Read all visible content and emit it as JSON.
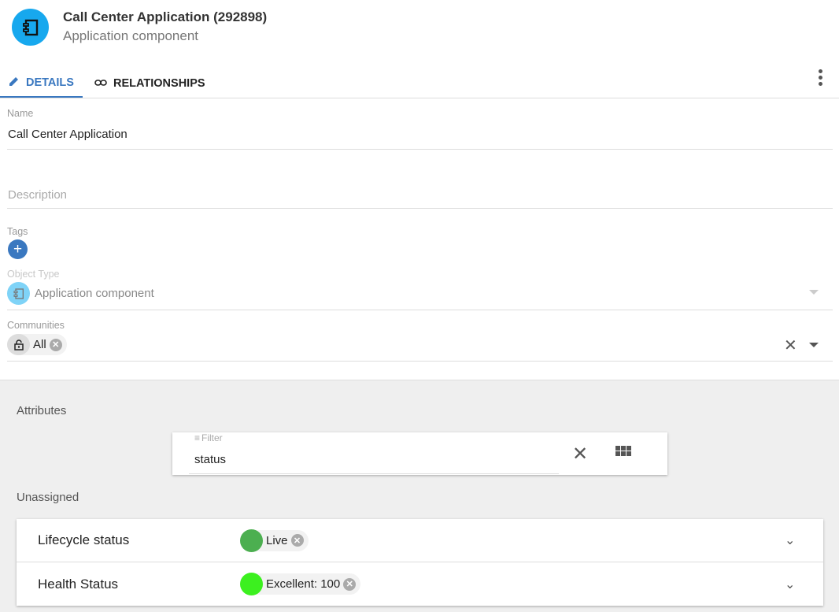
{
  "header": {
    "title": "Call Center Application (292898)",
    "subtitle": "Application component",
    "icon": "application-component-icon",
    "icon_color": "#17a8ee"
  },
  "tabs": [
    {
      "label": "DETAILS",
      "icon": "pencil-icon",
      "active": true
    },
    {
      "label": "RELATIONSHIPS",
      "icon": "link-icon",
      "active": false
    }
  ],
  "form": {
    "name_label": "Name",
    "name_value": "Call Center Application",
    "description_placeholder": "Description",
    "tags_label": "Tags",
    "object_type_label": "Object Type",
    "object_type_value": "Application component",
    "communities_label": "Communities",
    "community_chip": "All"
  },
  "attributes": {
    "title": "Attributes",
    "filter_label": "Filter",
    "filter_value": "status",
    "unassigned_label": "Unassigned",
    "rows": [
      {
        "name": "Lifecycle status",
        "value": "Live",
        "color": "#4caf50"
      },
      {
        "name": "Health Status",
        "value": "Excellent: 100",
        "color": "#3cf01f"
      }
    ]
  }
}
